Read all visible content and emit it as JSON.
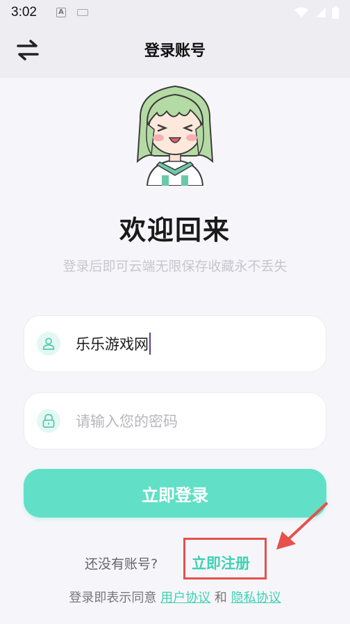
{
  "status_bar": {
    "time": "3:02",
    "icons": [
      "accessibility-a-icon",
      "keyboard-icon",
      "wifi-icon",
      "signal-icon",
      "battery-icon"
    ]
  },
  "header": {
    "title": "登录账号",
    "switch_icon": "swap-arrows-icon"
  },
  "welcome": {
    "title": "欢迎回来",
    "subtitle": "登录后即可云端无限保存收藏永不丢失"
  },
  "form": {
    "username": {
      "value": "乐乐游戏网",
      "icon": "user-icon"
    },
    "password": {
      "placeholder": "请输入您的密码",
      "icon": "lock-icon"
    },
    "login_label": "立即登录"
  },
  "register": {
    "prompt": "还没有账号?",
    "link": "立即注册"
  },
  "agreement": {
    "prefix": "登录即表示同意",
    "user_agreement": "用户协议",
    "conjunction": "和",
    "privacy_policy": "隐私协议"
  },
  "colors": {
    "accent": "#62e0c7",
    "link": "#3fd1b3",
    "annotation_red": "#e6504c"
  }
}
